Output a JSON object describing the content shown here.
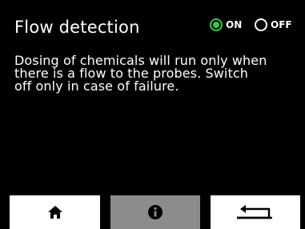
{
  "header": {
    "title": "Flow detection",
    "toggle": {
      "on_label": "ON",
      "off_label": "OFF",
      "selected": "ON",
      "on_color": "#2ecc40"
    }
  },
  "description": {
    "lines": [
      "Dosing of chemicals will run only when",
      "there is a flow to the probes. Switch",
      "off only in case of failure."
    ]
  },
  "nav": {
    "home_icon": "home-icon",
    "info_icon": "info-icon",
    "back_icon": "return-arrow-icon",
    "active": "info"
  }
}
